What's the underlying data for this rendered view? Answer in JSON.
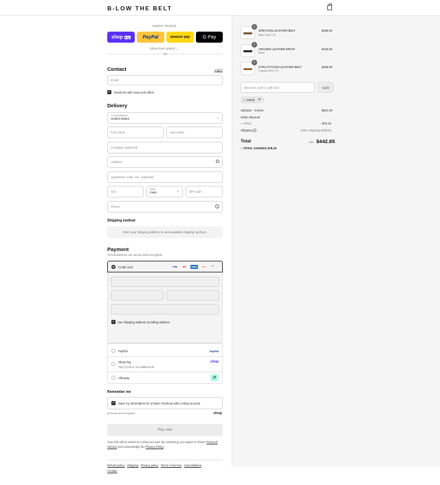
{
  "header": {
    "logo": "B-LOW THE BELT"
  },
  "express": {
    "label": "Express checkout",
    "shop_pay": "shop",
    "shop_pay_badge": "Pay",
    "paypal": "PayPal",
    "amazon_pay": "amazon pay",
    "google_pay": "G Pay",
    "show_more": "Show more options",
    "or": "OR"
  },
  "contact": {
    "title": "Contact",
    "login": "Log in",
    "email_placeholder": "Email",
    "newsletter": "Email me with news and offers"
  },
  "delivery": {
    "title": "Delivery",
    "country_label": "Country/Region",
    "country_value": "United States",
    "first_name": "First name",
    "last_name": "Last name",
    "company": "Company (optional)",
    "address": "Address",
    "apartment": "Apartment, suite, etc. (optional)",
    "city": "City",
    "state_label": "State",
    "state_value": "Iowa",
    "zip": "ZIP code",
    "phone": "Phone"
  },
  "shipping_method": {
    "title": "Shipping method",
    "message": "Enter your shipping address to view available shipping methods."
  },
  "payment": {
    "title": "Payment",
    "subtitle": "All transactions are secure and encrypted.",
    "credit_card": "Credit card",
    "cards": [
      "VISA",
      "MC",
      "AMEX",
      "DISC",
      "+5"
    ],
    "use_shipping": "Use shipping address as billing address",
    "paypal": "PayPal",
    "paypal_logo": "PayPal",
    "shop_pay": "Shop Pay",
    "shop_pay_sub": "Pay in full or in installments",
    "shop_pay_logo": "shop",
    "afterpay": "Afterpay"
  },
  "remember": {
    "title": "Remember me",
    "save": "Save my information for a faster checkout with a Shop account",
    "secure": "Secure and encrypted",
    "shop_logo": "shop"
  },
  "pay_now": "Pay now",
  "disclaimer": {
    "text1": "Your info will be saved to a Shop account. By continuing, you agree to Shop's",
    "terms": "Terms of Service",
    "and": "and acknowledge the",
    "privacy": "Privacy Policy",
    "end": "."
  },
  "footer": {
    "links": [
      "Refund policy",
      "Shipping",
      "Privacy policy",
      "Terms of service",
      "Cancellations",
      "Contact"
    ]
  },
  "cart": {
    "items": [
      {
        "name": "GREYSON LEATHER BELT",
        "variant": "Black Gold / XS",
        "price": "$188.00",
        "qty": "1"
      },
      {
        "name": "ARCHER LEATHER WRAP",
        "variant": "Black",
        "price": "$145.00",
        "qty": "1"
      },
      {
        "name": "KYRA PYTHON LEATHER BELT",
        "variant": "Cognac Gold / XS",
        "price": "$188.00",
        "qty": "1"
      }
    ],
    "discount_placeholder": "Discount code or gift card",
    "apply": "Apply",
    "code_tag": "VIP15",
    "subtotal_label": "Subtotal · 3 items",
    "subtotal": "$521.00",
    "order_discount": "Order discount",
    "discount_code": "VIP15",
    "discount_amount": "- $78.15",
    "shipping_label": "Shipping",
    "shipping_value": "Enter shipping address",
    "total_label": "Total",
    "currency": "USD",
    "total": "$442.85",
    "savings_label": "TOTAL SAVINGS",
    "savings": "$78.15"
  }
}
